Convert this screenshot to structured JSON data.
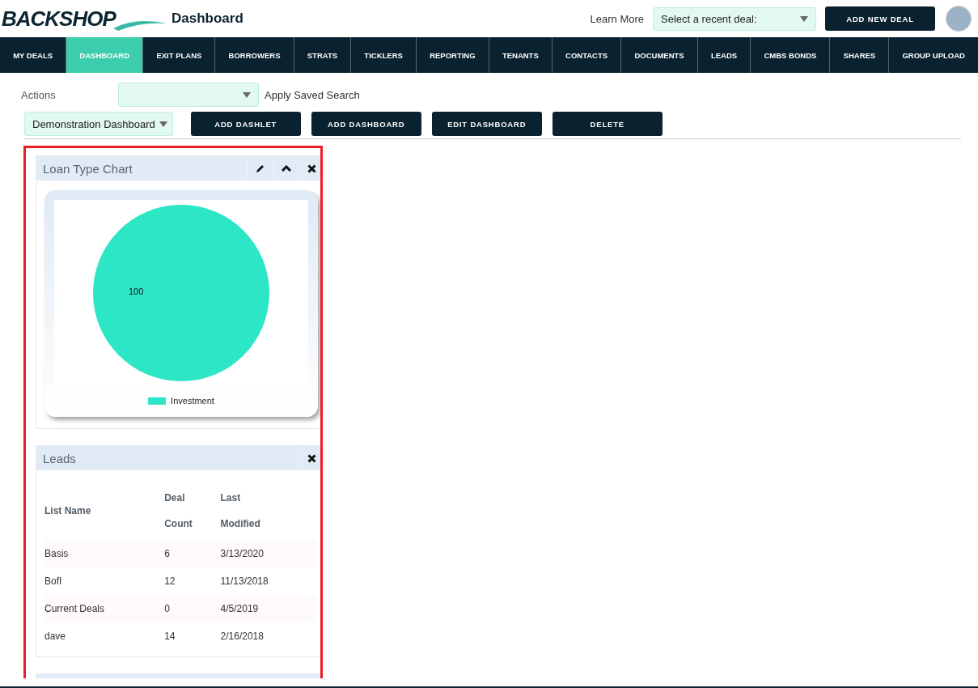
{
  "header": {
    "logo": "BACKSHOP",
    "page_title": "Dashboard",
    "learn_more": "Learn More",
    "recent_deal": {
      "placeholder": "Select a recent deal:"
    },
    "add_button": "ADD NEW DEAL"
  },
  "nav": [
    {
      "label": "MY DEALS",
      "selected": false
    },
    {
      "label": "DASHBOARD",
      "selected": true
    },
    {
      "label": "EXIT PLANS",
      "selected": false
    },
    {
      "label": "BORROWERS",
      "selected": false
    },
    {
      "label": "STRATS",
      "selected": false
    },
    {
      "label": "TICKLERS",
      "selected": false
    },
    {
      "label": "REPORTING",
      "selected": false
    },
    {
      "label": "TENANTS",
      "selected": false
    },
    {
      "label": "CONTACTS",
      "selected": false
    },
    {
      "label": "DOCUMENTS",
      "selected": false
    },
    {
      "label": "LEADS",
      "selected": false
    },
    {
      "label": "CMBS BONDS",
      "selected": false
    },
    {
      "label": "SHARES",
      "selected": false
    },
    {
      "label": "GROUP UPLOAD",
      "selected": false
    }
  ],
  "actions": {
    "label": "Actions",
    "saved_search": "Apply Saved Search"
  },
  "dashboard_select": "Demonstration Dashboard",
  "toolbar": [
    "ADD DASHLET",
    "ADD DASHBOARD",
    "EDIT DASHBOARD",
    "DELETE"
  ],
  "dashlets": [
    {
      "kind": "chart",
      "title": "Loan Type Chart",
      "controls": [
        {
          "kind": "edit"
        },
        {
          "kind": "collapse"
        },
        {
          "kind": "close"
        }
      ],
      "chart_data": {
        "type": "pie",
        "categories": [
          "Investment"
        ],
        "series": [
          {
            "color": "#2de6c6",
            "values": [
              100
            ]
          }
        ],
        "data_labels": true
      }
    },
    {
      "kind": "table",
      "title": "Leads",
      "controls": [
        {
          "kind": "close"
        }
      ],
      "columns": [
        {
          "lines": [
            "List Name"
          ]
        },
        {
          "lines": [
            "Deal",
            "Count"
          ]
        },
        {
          "lines": [
            "Last",
            "Modified"
          ]
        }
      ],
      "rows": [
        [
          "Basis",
          "6",
          "3/13/2020"
        ],
        [
          "BofI",
          "12",
          "11/13/2018"
        ],
        [
          "Current Deals",
          "0",
          "4/5/2019"
        ],
        [
          "dave",
          "14",
          "2/16/2018"
        ]
      ]
    },
    {
      "kind": "empty"
    }
  ]
}
